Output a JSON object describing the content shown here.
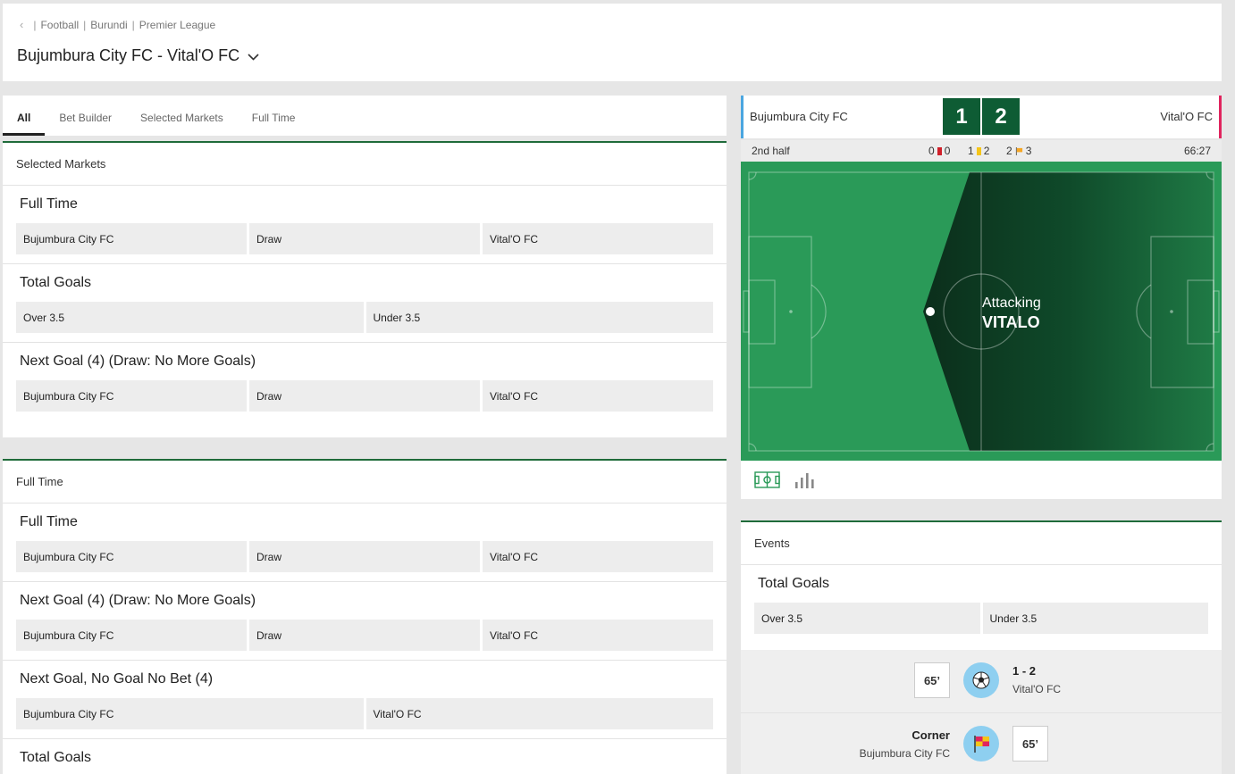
{
  "breadcrumb": {
    "back_icon": "chevron-left-icon",
    "items": [
      "Football",
      "Burundi",
      "Premier League"
    ]
  },
  "match": {
    "title": "Bujumbura City FC - Vital'O FC"
  },
  "tabs": [
    "All",
    "Bet Builder",
    "Selected Markets",
    "Full Time"
  ],
  "selected_markets": {
    "title": "Selected Markets",
    "markets": [
      {
        "name": "Full Time",
        "options": [
          "Bujumbura City FC",
          "Draw",
          "Vital'O FC"
        ]
      },
      {
        "name": "Total Goals",
        "options": [
          "Over 3.5",
          "Under 3.5"
        ]
      },
      {
        "name": "Next Goal (4) (Draw: No More Goals)",
        "options": [
          "Bujumbura City FC",
          "Draw",
          "Vital'O FC"
        ]
      }
    ]
  },
  "full_time": {
    "title": "Full Time",
    "markets": [
      {
        "name": "Full Time",
        "options": [
          "Bujumbura City FC",
          "Draw",
          "Vital'O FC"
        ]
      },
      {
        "name": "Next Goal (4) (Draw: No More Goals)",
        "options": [
          "Bujumbura City FC",
          "Draw",
          "Vital'O FC"
        ]
      },
      {
        "name": "Next Goal, No Goal No Bet (4)",
        "options": [
          "Bujumbura City FC",
          "Vital'O FC"
        ]
      },
      {
        "name": "Total Goals",
        "options": []
      }
    ]
  },
  "scoreboard": {
    "home_team": "Bujumbura City FC",
    "away_team": "Vital'O FC",
    "home_score": "1",
    "away_score": "2",
    "home_color": "#4aa6e0",
    "away_color": "#e0245e",
    "period": "2nd half",
    "clock": "66:27",
    "stats": {
      "red_home": "0",
      "red_away": "0",
      "yellow_home": "1",
      "yellow_away": "2",
      "corner_home": "2",
      "corner_away": "3"
    }
  },
  "pitch": {
    "attack_label": "Attacking",
    "attack_team": "VITALO"
  },
  "events": {
    "title": "Events",
    "market": {
      "name": "Total Goals",
      "options": [
        "Over 3.5",
        "Under 3.5"
      ]
    },
    "timeline": [
      {
        "minute": "65’",
        "type": "goal",
        "icon": "soccer-ball-icon",
        "main": "1 - 2",
        "sub": "Vital'O FC",
        "side": "away"
      },
      {
        "minute": "65’",
        "type": "corner",
        "icon": "corner-flag-icon",
        "main": "Corner",
        "sub": "Bujumbura City FC",
        "side": "home"
      }
    ]
  },
  "colors": {
    "accent_green": "#1f6b3a",
    "score_green": "#0e5c34",
    "pitch_green": "#2a9a58"
  }
}
